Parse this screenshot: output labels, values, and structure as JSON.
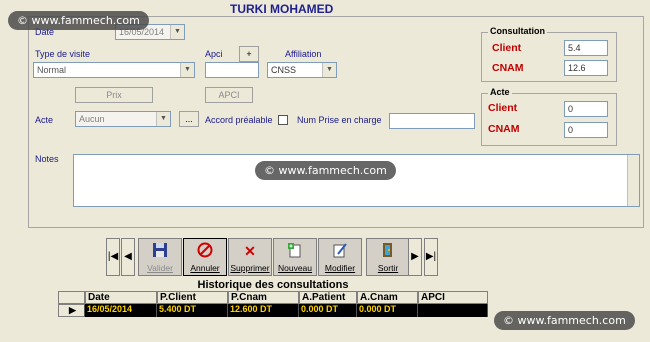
{
  "watermark": "© www.fammech.com",
  "patient_name": "TURKI MOHAMED",
  "form": {
    "date_label": "Date",
    "date_value": "16/05/2014",
    "type_visite_label": "Type de visite",
    "type_visite_value": "Normal",
    "apci_label": "Apci",
    "apci_plus": "+",
    "affiliation_label": "Affiliation",
    "affiliation_value": "CNSS",
    "prix_button": "Prix",
    "apci_button": "APCI",
    "acte_label": "Acte",
    "acte_value": "Aucun",
    "acte_more": "...",
    "accord_label": "Accord préalable",
    "num_prise_label": "Num Prise en charge",
    "notes_label": "Notes"
  },
  "consultation": {
    "title": "Consultation",
    "client_label": "Client",
    "client_value": "5.4",
    "cnam_label": "CNAM",
    "cnam_value": "12.6"
  },
  "acte_box": {
    "title": "Acte",
    "client_label": "Client",
    "client_value": "0",
    "cnam_label": "CNAM",
    "cnam_value": "0"
  },
  "toolbar": {
    "first": "|◀",
    "prev": "◀",
    "next": "▶",
    "last": "▶|",
    "valider": "Valider",
    "annuler": "Annuler",
    "supprimer": "Supprimer",
    "nouveau": "Nouveau",
    "modifier": "Modifier",
    "sortir": "Sortir"
  },
  "history": {
    "title": "Historique des consultations",
    "columns": [
      "Date",
      "P.Client",
      "P.Cnam",
      "A.Patient",
      "A.Cnam",
      "APCI"
    ],
    "rows": [
      [
        "16/05/2014",
        "5.400 DT",
        "12.600 DT",
        "0.000 DT",
        "0.000 DT",
        ""
      ]
    ]
  },
  "colors": {
    "title": "#1f1f8f",
    "group_label": "#c00000",
    "grid_selected_bg": "#000000",
    "grid_selected_fg": "#ffd400"
  }
}
